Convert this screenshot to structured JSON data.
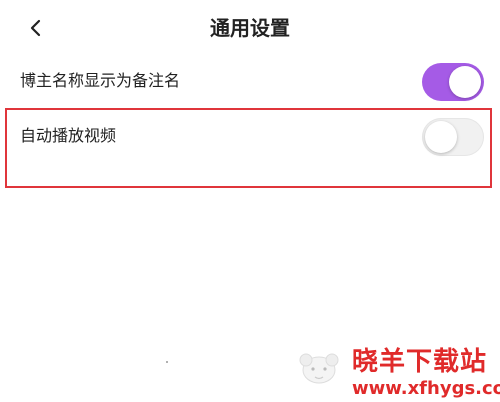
{
  "header": {
    "back_icon": "chevron-left-icon",
    "title": "通用设置"
  },
  "settings": [
    {
      "label": "博主名称显示为备注名",
      "enabled": true
    },
    {
      "label": "自动播放视频",
      "enabled": false
    }
  ],
  "annotation": {
    "highlight_color": "#e0353b",
    "highlighted_setting": "自动播放视频"
  },
  "colors": {
    "toggle_on": "#a55be6",
    "toggle_off": "#f1f1f1",
    "watermark": "#e02a2a"
  },
  "watermark": {
    "logo_icon": "sheep-logo-icon",
    "title": "晓羊下载站",
    "url": "www.xfhygs.com"
  }
}
